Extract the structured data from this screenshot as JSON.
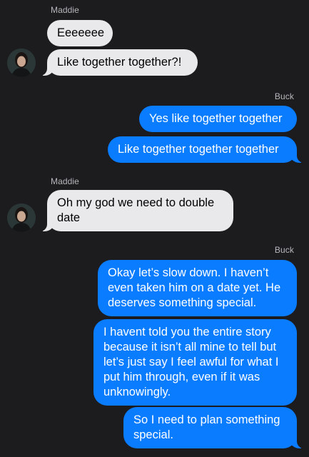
{
  "thread": {
    "groups": [
      {
        "sender": "Maddie",
        "messages": [
          "Eeeeeee",
          "Like together together?!"
        ]
      },
      {
        "sender": "Buck",
        "messages": [
          "Yes like together together",
          "Like together together together"
        ]
      },
      {
        "sender": "Maddie",
        "messages": [
          "Oh my god we need to double date"
        ]
      },
      {
        "sender": "Buck",
        "messages": [
          "Okay let’s slow down. I haven’t even taken him on a date yet. He deserves something special.",
          "I havent told you the entire story because it isn’t all mine to tell but let’s just say I feel awful for what I put him through, even if it was unknowingly.",
          "So I need to plan something special."
        ]
      }
    ]
  },
  "colors": {
    "background": "#1c1c1e",
    "incoming_bubble": "#e9e9eb",
    "outgoing_bubble": "#0a7cff",
    "sender_label": "#b7b7bc"
  },
  "icons": {
    "avatar": "contact-avatar-photo"
  }
}
